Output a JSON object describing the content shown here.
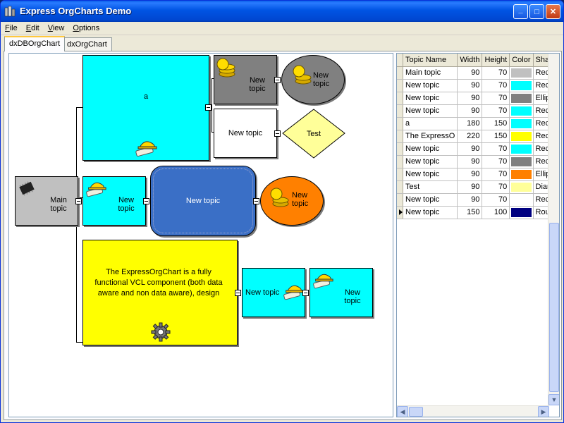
{
  "window": {
    "title": "Express OrgCharts Demo",
    "min_glyph": "_",
    "max_glyph": "□",
    "close_glyph": "✕"
  },
  "menu": [
    {
      "underline": "F",
      "rest": "ile"
    },
    {
      "underline": "E",
      "rest": "dit"
    },
    {
      "underline": "V",
      "rest": "iew"
    },
    {
      "underline": "O",
      "rest": "ptions"
    }
  ],
  "tabs": [
    "dxDBOrgChart",
    "dxOrgChart"
  ],
  "chart": {
    "nodes": {
      "main": "Main topic",
      "a": "a",
      "top_gray": "New topic",
      "top_gray_ellipse": "New topic",
      "white": "New topic",
      "test_diamond": "Test",
      "mid_cyan": "New topic",
      "mid_blue": "New topic",
      "mid_orange": "New topic",
      "yellow": "The ExpressOrgChart is a fully functional VCL component (both data aware and non data aware), design",
      "bottom_cyan1": "New topic",
      "bottom_cyan2": "New topic"
    },
    "colors": {
      "cyan": "#00ffff",
      "gray": "#808080",
      "silver": "#c0c0c0",
      "blue": "#3a6fc6",
      "orange": "#ff8000",
      "yellow": "#ffff00",
      "light_yellow": "#ffff99",
      "navy": "#000080",
      "white": "#ffffff"
    }
  },
  "grid": {
    "columns": [
      "Topic Name",
      "Width",
      "Height",
      "Color",
      "Shape"
    ],
    "rows": [
      {
        "name": "Main topic",
        "width": "90",
        "height": "70",
        "color": "#c0c0c0",
        "shape": "Rectan"
      },
      {
        "name": "New topic",
        "width": "90",
        "height": "70",
        "color": "#00ffff",
        "shape": "Rectan"
      },
      {
        "name": "New topic",
        "width": "90",
        "height": "70",
        "color": "#808080",
        "shape": "Ellipse"
      },
      {
        "name": "New topic",
        "width": "90",
        "height": "70",
        "color": "#00ffff",
        "shape": "Rectan"
      },
      {
        "name": "a",
        "width": "180",
        "height": "150",
        "color": "#00ffff",
        "shape": "Rectan"
      },
      {
        "name": "The ExpressO",
        "width": "220",
        "height": "150",
        "color": "#ffff00",
        "shape": "Rectan"
      },
      {
        "name": "New topic",
        "width": "90",
        "height": "70",
        "color": "#00ffff",
        "shape": "Rectan"
      },
      {
        "name": "New topic",
        "width": "90",
        "height": "70",
        "color": "#808080",
        "shape": "Rectan"
      },
      {
        "name": "New topic",
        "width": "90",
        "height": "70",
        "color": "#ff8000",
        "shape": "Ellipse"
      },
      {
        "name": "Test",
        "width": "90",
        "height": "70",
        "color": "#ffff99",
        "shape": "Diamor"
      },
      {
        "name": "New topic",
        "width": "90",
        "height": "70",
        "color": "#ffffff",
        "shape": "Rectan"
      },
      {
        "name": "New topic",
        "width": "150",
        "height": "100",
        "color": "#000080",
        "shape": "Round"
      }
    ],
    "current_row": 11
  }
}
